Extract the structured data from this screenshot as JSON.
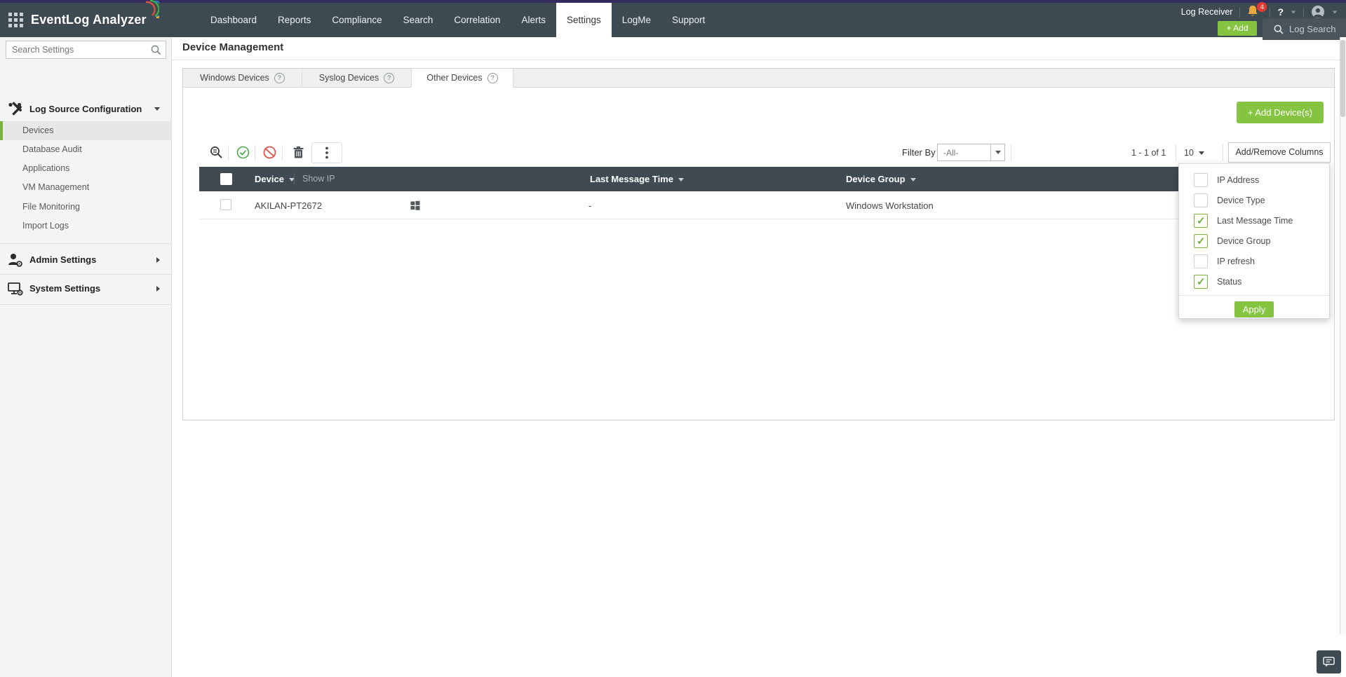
{
  "colors": {
    "top_strip": "#332b5e",
    "navbar": "#3e4a52",
    "accent_green": "#85c440",
    "checkbox_green": "#7cb442",
    "table_header": "#3f4a52",
    "danger_red": "#de5449",
    "success_green": "#52a949",
    "notification_red": "#e23c33"
  },
  "topbar": {
    "product_name": "EventLog Analyzer",
    "nav": [
      {
        "label": "Dashboard",
        "active": false
      },
      {
        "label": "Reports",
        "active": false
      },
      {
        "label": "Compliance",
        "active": false
      },
      {
        "label": "Search",
        "active": false
      },
      {
        "label": "Correlation",
        "active": false
      },
      {
        "label": "Alerts",
        "active": false
      },
      {
        "label": "Settings",
        "active": true
      },
      {
        "label": "LogMe",
        "active": false
      },
      {
        "label": "Support",
        "active": false
      }
    ],
    "log_receiver_label": "Log Receiver",
    "notification_count": "4",
    "help_label": "?",
    "add_button_label": "+ Add",
    "log_search_label": "Log Search"
  },
  "sidebar": {
    "search_placeholder": "Search Settings",
    "section_label": "Log Source Configuration",
    "items": [
      {
        "label": "Devices",
        "selected": true
      },
      {
        "label": "Database Audit",
        "selected": false
      },
      {
        "label": "Applications",
        "selected": false
      },
      {
        "label": "VM Management",
        "selected": false
      },
      {
        "label": "File Monitoring",
        "selected": false
      },
      {
        "label": "Import Logs",
        "selected": false
      }
    ],
    "groups": [
      {
        "label": "Admin Settings"
      },
      {
        "label": "System Settings"
      }
    ]
  },
  "main": {
    "page_title": "Device Management",
    "help_glyph": "?",
    "tabs": [
      {
        "label": "Windows Devices",
        "active": false
      },
      {
        "label": "Syslog Devices",
        "active": false
      },
      {
        "label": "Other Devices",
        "active": true
      }
    ],
    "add_device_label": "+ Add Device(s)",
    "toolbar": {
      "filter_by_label": "Filter By",
      "filter_value": "-All-",
      "range_label": "1 - 1 of 1",
      "page_size": "10",
      "add_remove_columns_label": "Add/Remove Columns"
    },
    "table": {
      "columns": {
        "device": "Device",
        "show_ip": "Show IP",
        "last_message_time": "Last Message Time",
        "device_group": "Device Group"
      },
      "rows": [
        {
          "device": "AKILAN-PT2672",
          "last_message_time": "-",
          "device_group": "Windows Workstation"
        }
      ]
    },
    "columns_dropdown": {
      "options": [
        {
          "label": "IP Address",
          "checked": false
        },
        {
          "label": "Device Type",
          "checked": false
        },
        {
          "label": "Last Message Time",
          "checked": true
        },
        {
          "label": "Device Group",
          "checked": true
        },
        {
          "label": "IP refresh",
          "checked": false
        },
        {
          "label": "Status",
          "checked": true
        }
      ],
      "apply_label": "Apply"
    }
  }
}
